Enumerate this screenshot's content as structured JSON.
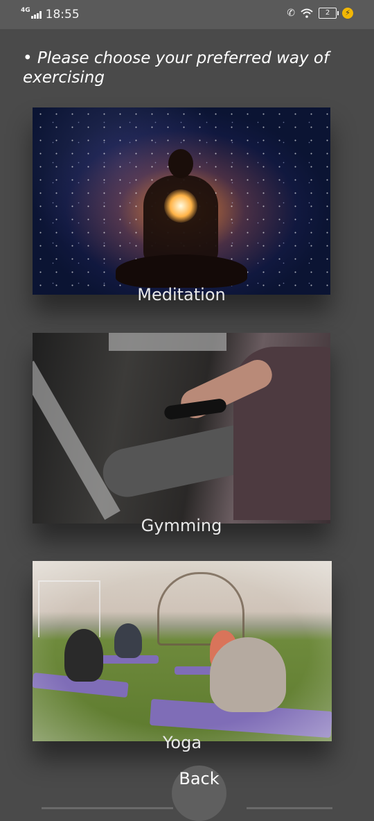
{
  "status_bar": {
    "network": "4G",
    "time": "18:55",
    "battery_level": "2",
    "icons": [
      "signal-icon",
      "call-forward-icon",
      "wifi-icon",
      "battery-icon",
      "charging-bolt-icon"
    ]
  },
  "prompt": {
    "bullet": "•",
    "text": "Please choose your preferred way of exercising"
  },
  "options": [
    {
      "label": "Meditation",
      "image": "meditation-image"
    },
    {
      "label": "Gymming",
      "image": "gymming-image"
    },
    {
      "label": "Yoga",
      "image": "yoga-image"
    }
  ],
  "back_button": {
    "label": "Back"
  },
  "colors": {
    "background": "#4a4a4a",
    "status_bar": "#5a5a5a",
    "label_text": "#e8e8e8",
    "button": "#5f5f5f"
  }
}
